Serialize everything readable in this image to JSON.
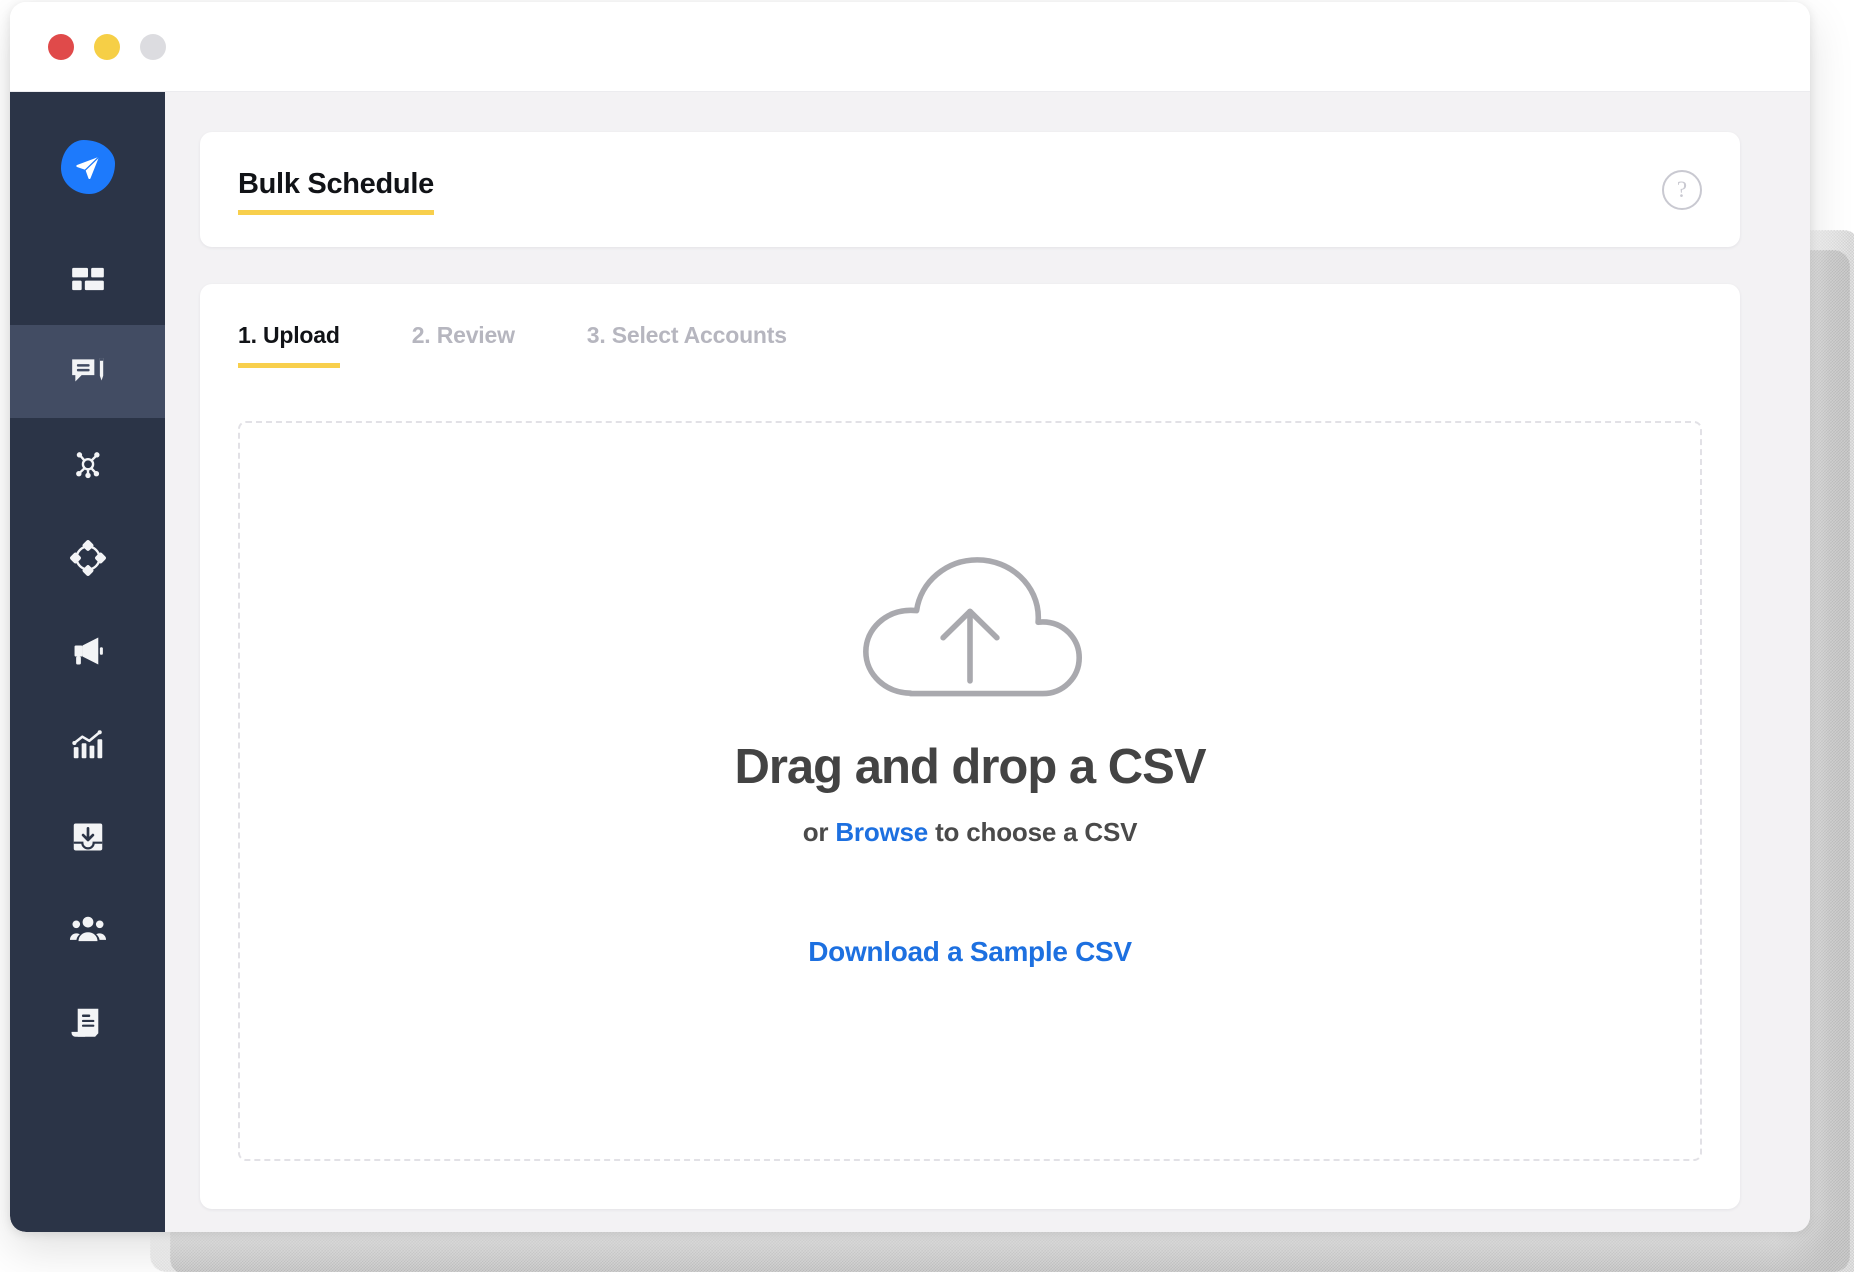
{
  "window": {
    "traffic_lights": [
      {
        "name": "close",
        "color": "#e04a4a"
      },
      {
        "name": "minimize",
        "color": "#f6cf46"
      },
      {
        "name": "zoom",
        "color": "#dcdce0"
      }
    ]
  },
  "sidebar": {
    "background": "#2b3447",
    "active_background": "#424c63",
    "logo": {
      "icon": "paper-plane-icon",
      "color": "#1d7afc"
    },
    "items": [
      {
        "icon": "dashboard-grid-icon",
        "active": false
      },
      {
        "icon": "compose-message-icon",
        "active": true
      },
      {
        "icon": "network-nodes-icon",
        "active": false
      },
      {
        "icon": "engage-cycle-icon",
        "active": false
      },
      {
        "icon": "megaphone-icon",
        "active": false
      },
      {
        "icon": "analytics-chart-icon",
        "active": false
      },
      {
        "icon": "inbox-download-icon",
        "active": false
      },
      {
        "icon": "team-people-icon",
        "active": false
      },
      {
        "icon": "report-document-icon",
        "active": false
      }
    ]
  },
  "header": {
    "title": "Bulk Schedule",
    "underline_color": "#f8cf4c",
    "help_icon": "question-mark-icon",
    "help_glyph": "?"
  },
  "main": {
    "tabs": [
      {
        "label": "1. Upload",
        "active": true
      },
      {
        "label": "2. Review",
        "active": false
      },
      {
        "label": "3. Select Accounts",
        "active": false
      }
    ],
    "dropzone": {
      "icon": "cloud-upload-icon",
      "title": "Drag and drop a CSV",
      "sub_prefix": "or ",
      "sub_link": "Browse",
      "sub_suffix": " to choose a CSV",
      "sample_link": "Download a Sample CSV",
      "link_color": "#1d70e0",
      "border_color": "#e2e1e6"
    }
  }
}
